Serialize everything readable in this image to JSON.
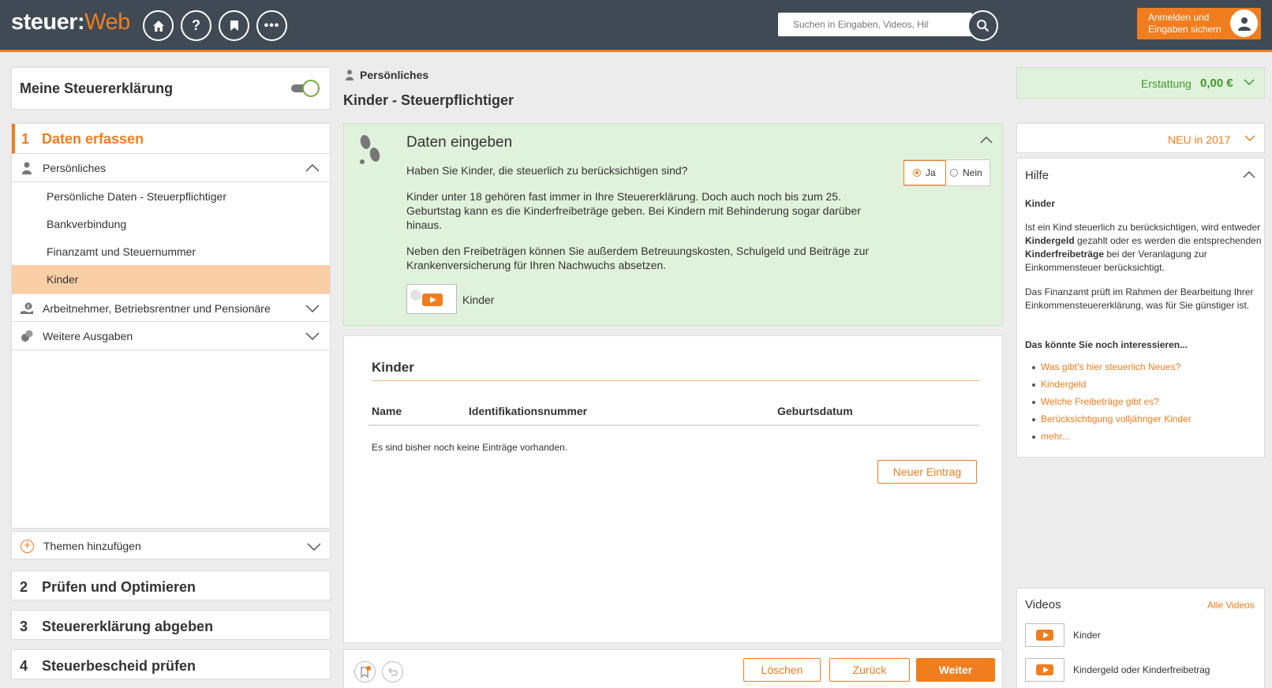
{
  "header": {
    "logo_part1": "steuer:",
    "logo_part2": "Web",
    "nav_buttons": [
      "home-icon",
      "help-icon",
      "bookmark-icon",
      "more-icon"
    ],
    "search_placeholder": "Suchen in Eingaben, Videos, Hilfe...",
    "login_line1": "Anmelden und",
    "login_line2": "Eingaben sichern"
  },
  "sidebar": {
    "mine_title": "Meine Steuererklärung",
    "step1_num": "1",
    "step1_label": "Daten erfassen",
    "section_personal": "Persönliches",
    "personal_items": [
      "Persönliche Daten - Steuerpflichtiger",
      "Bankverbindung",
      "Finanzamt und Steuernummer",
      "Kinder"
    ],
    "section_employee": "Arbeitnehmer, Betriebsrentner und Pensionäre",
    "section_expenses": "Weitere Ausgaben",
    "add_topics": "Themen hinzufügen",
    "steps": [
      {
        "num": "2",
        "label": "Prüfen und Optimieren"
      },
      {
        "num": "3",
        "label": "Steuererklärung abgeben"
      },
      {
        "num": "4",
        "label": "Steuerbescheid prüfen"
      }
    ]
  },
  "main": {
    "breadcrumb": "Persönliches",
    "title": "Kinder - Steuerpflichtiger",
    "entry": {
      "title": "Daten eingeben",
      "question": "Haben Sie Kinder, die steuerlich zu berücksichtigen sind?",
      "para1": "Kinder unter 18 gehören fast immer in Ihre Steuererklärung. Doch auch noch bis zum 25. Geburtstag kann es die Kinderfreibeträge geben. Bei Kindern mit Behinderung sogar darüber hinaus.",
      "para2": "Neben den Freibeträgen können Sie außerdem Betreuungskosten, Schulgeld und Beiträge zur Krankenversicherung für Ihren Nachwuchs absetzen.",
      "yes": "Ja",
      "no": "Nein",
      "selected": "Ja",
      "video_label": "Kinder"
    },
    "list": {
      "title": "Kinder",
      "columns": [
        "Name",
        "Identifikationsnummer",
        "Geburtsdatum"
      ],
      "empty_text": "Es sind bisher noch keine Einträge vorhanden.",
      "new_button": "Neuer Eintrag"
    },
    "footer": {
      "delete": "Löschen",
      "back": "Zurück",
      "next": "Weiter"
    }
  },
  "right": {
    "refund_label": "Erstattung",
    "refund_value": "0,00 €",
    "new_label": "NEU in 2017",
    "help": {
      "title": "Hilfe",
      "subtitle": "Kinder",
      "p1_a": "Ist ein Kind steuerlich zu berücksichtigen, wird entweder ",
      "p1_b": "Kindergeld",
      "p1_c": " gezahlt oder es werden die entsprechenden ",
      "p1_d": "Kinderfreibeträge",
      "p1_e": " bei der Veranlagung zur Einkommensteuer berücksichtigt.",
      "p2": "Das Finanzamt prüft im Rahmen der Bearbeitung Ihrer Einkommensteuererklärung, was für Sie günstiger ist.",
      "more_title": "Das könnte Sie noch interessieren...",
      "links": [
        "Was gibt's hier steuerlich Neues?",
        "Kindergeld",
        "Welche Freibeträge gibt es?",
        "Berücksichtigung volljähriger Kinder",
        "mehr..."
      ]
    },
    "videos": {
      "title": "Videos",
      "all": "Alle Videos",
      "items": [
        "Kinder",
        "Kindergeld oder Kinderfreibetrag"
      ]
    }
  },
  "colors": {
    "accent": "#f07d1e",
    "header_bg": "#3f4a55",
    "success_bg": "#e0f2db",
    "success_text": "#3f9a2c",
    "active_nav": "#fbcfa6"
  }
}
